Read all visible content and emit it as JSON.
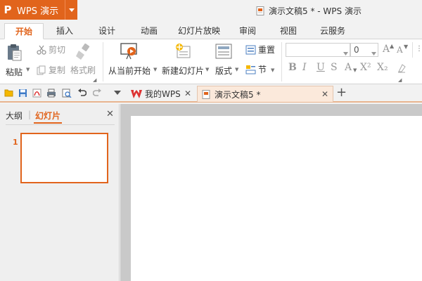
{
  "app": {
    "name": "WPS 演示",
    "logo": "P"
  },
  "window": {
    "title": "演示文稿5 * - WPS 演示"
  },
  "ribbon_tabs": [
    "开始",
    "插入",
    "设计",
    "动画",
    "幻灯片放映",
    "审阅",
    "视图",
    "云服务"
  ],
  "ribbon": {
    "paste": "粘贴",
    "cut": "剪切",
    "copy": "复制",
    "format_painter": "格式刷",
    "from_current": "从当前开始",
    "new_slide": "新建幻灯片",
    "layout": "版式",
    "reset": "重置",
    "section": "节",
    "font_size": "0",
    "fmt_bold": "B",
    "fmt_italic": "I",
    "fmt_underline": "U",
    "fmt_strike": "S",
    "fmt_grow": "A",
    "fmt_shrink": "A",
    "fmt_superscript": "X²",
    "fmt_subscript": "X₂"
  },
  "doc_tabs": [
    {
      "label": "我的WPS",
      "active": false
    },
    {
      "label": "演示文稿5 *",
      "active": true
    }
  ],
  "left_pane": {
    "tabs": [
      "大纲",
      "幻灯片"
    ],
    "slide_number": "1"
  },
  "colors": {
    "accent": "#e1641c",
    "canvas": "#c9c9c9"
  }
}
